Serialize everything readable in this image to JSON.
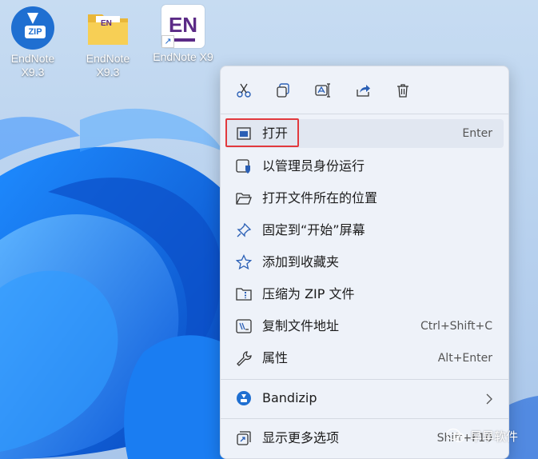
{
  "desktop": {
    "icons": [
      {
        "label": "EndNote X9.3",
        "icon": "zip-archive-icon"
      },
      {
        "label": "EndNote X9.3",
        "icon": "folder-icon"
      },
      {
        "label": "EndNote X9",
        "icon": "endnote-app-icon"
      }
    ],
    "shortcut_badge": "↗",
    "zip_text": "ZIP",
    "en_text": "EN"
  },
  "context_menu": {
    "quick_actions": [
      {
        "name": "cut",
        "icon": "scissors-icon"
      },
      {
        "name": "copy",
        "icon": "copy-icon"
      },
      {
        "name": "rename",
        "icon": "rename-icon"
      },
      {
        "name": "share",
        "icon": "share-icon"
      },
      {
        "name": "delete",
        "icon": "trash-icon"
      }
    ],
    "items": [
      {
        "label": "打开",
        "shortcut": "Enter",
        "icon": "open-window-icon"
      },
      {
        "label": "以管理员身份运行",
        "shortcut": "",
        "icon": "shield-window-icon"
      },
      {
        "label": "打开文件所在的位置",
        "shortcut": "",
        "icon": "folder-open-icon"
      },
      {
        "label": "固定到“开始”屏幕",
        "shortcut": "",
        "icon": "pin-icon"
      },
      {
        "label": "添加到收藏夹",
        "shortcut": "",
        "icon": "star-icon"
      },
      {
        "label": "压缩为 ZIP 文件",
        "shortcut": "",
        "icon": "zip-folder-icon"
      },
      {
        "label": "复制文件地址",
        "shortcut": "Ctrl+Shift+C",
        "icon": "copy-path-icon"
      },
      {
        "label": "属性",
        "shortcut": "Alt+Enter",
        "icon": "wrench-icon"
      },
      {
        "label": "Bandizip",
        "shortcut": "",
        "icon": "bandizip-icon"
      },
      {
        "label": "显示更多选项",
        "shortcut": "Shift+F10",
        "icon": "more-options-icon"
      }
    ],
    "submenu_chevron": "›"
  },
  "watermark": {
    "text": "早早软件",
    "icon": "wechat-icon"
  },
  "colors": {
    "accent": "#1f6fd1",
    "highlight_border": "#e2393e",
    "menu_bg": "#eef2f9",
    "wallpaper_blue": "#0a57d8"
  }
}
